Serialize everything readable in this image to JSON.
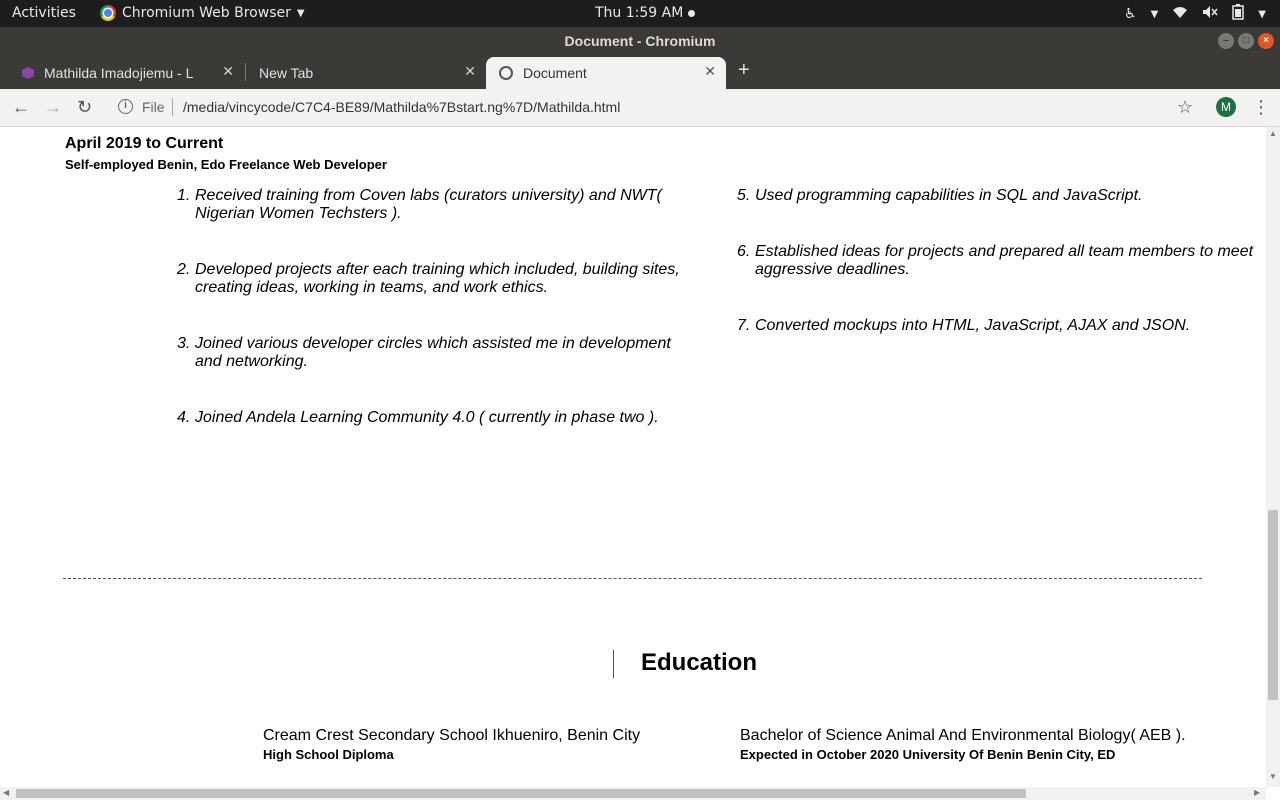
{
  "system_bar": {
    "activities": "Activities",
    "app_name": "Chromium Web Browser",
    "clock": "Thu  1:59 AM"
  },
  "window": {
    "title": "Document - Chromium"
  },
  "tabs": [
    {
      "label": "Mathilda Imadojiemu - Lu"
    },
    {
      "label": "New Tab"
    },
    {
      "label": "Document"
    }
  ],
  "toolbar": {
    "scheme_label": "File",
    "url": "/media/vincycode/C7C4-BE89/Mathilda%7Bstart.ng%7D/Mathilda.html",
    "avatar_initial": "M"
  },
  "experience": {
    "period": "April 2019 to Current",
    "role": "Self-employed Benin, Edo Freelance Web Developer",
    "duties": [
      {
        "num": "1.",
        "text": "Received training from Coven labs (curators university) and NWT( Nigerian Women Techsters )."
      },
      {
        "num": "2.",
        "text": "Developed projects after each training which included, building sites, creating ideas, working in teams, and work ethics."
      },
      {
        "num": "3.",
        "text": "Joined various developer circles which assisted me in development and networking."
      },
      {
        "num": "4.",
        "text": "Joined Andela Learning Community 4.0 ( currently in phase two )."
      },
      {
        "num": "5.",
        "text": "Used programming capabilities in SQL and JavaScript."
      },
      {
        "num": "6.",
        "text": "Established ideas for projects and prepared all team members to meet aggressive deadlines."
      },
      {
        "num": "7.",
        "text": "Converted mockups into HTML, JavaScript, AJAX and JSON."
      }
    ]
  },
  "education": {
    "heading": "Education",
    "entries": [
      {
        "school": "Cream Crest Secondary School Ikhueniro, Benin City",
        "detail": "High School Diploma"
      },
      {
        "school": "Bachelor of Science Animal And Environmental Biology( AEB ).",
        "detail": "Expected in October 2020 University Of Benin Benin City, ED"
      }
    ]
  }
}
